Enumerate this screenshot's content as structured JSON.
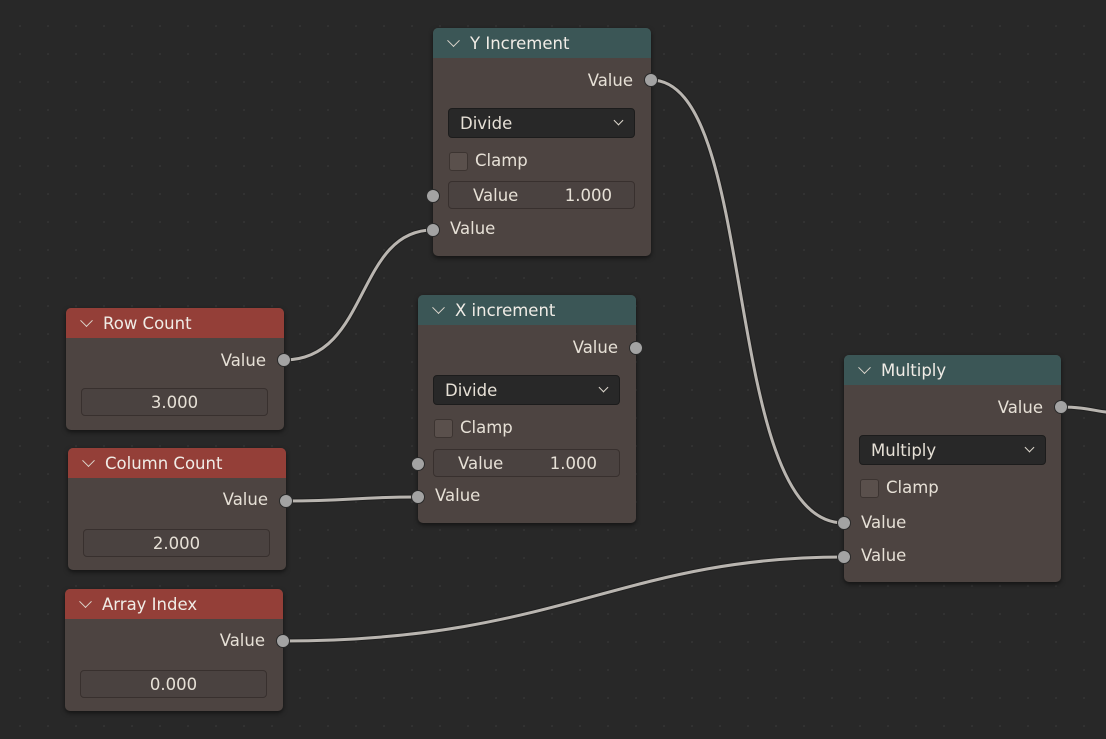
{
  "nodes": {
    "y_increment": {
      "title": "Y Increment",
      "output_label": "Value",
      "operation": "Divide",
      "clamp_label": "Clamp",
      "field_label": "Value",
      "field_value": "1.000",
      "input_label": "Value"
    },
    "x_increment": {
      "title": "X increment",
      "output_label": "Value",
      "operation": "Divide",
      "clamp_label": "Clamp",
      "field_label": "Value",
      "field_value": "1.000",
      "input_label": "Value"
    },
    "row_count": {
      "title": "Row Count",
      "output_label": "Value",
      "value": "3.000"
    },
    "column_count": {
      "title": "Column Count",
      "output_label": "Value",
      "value": "2.000"
    },
    "array_index": {
      "title": "Array Index",
      "output_label": "Value",
      "value": "0.000"
    },
    "multiply": {
      "title": "Multiply",
      "output_label": "Value",
      "operation": "Multiply",
      "clamp_label": "Clamp",
      "input1_label": "Value",
      "input2_label": "Value"
    }
  },
  "colors": {
    "input_node_header": "#943f38",
    "math_node_header": "#3b5656",
    "node_body": "#4d4441",
    "wire": "#b9b5b0",
    "socket": "#a3a3a3",
    "background": "#282828"
  }
}
